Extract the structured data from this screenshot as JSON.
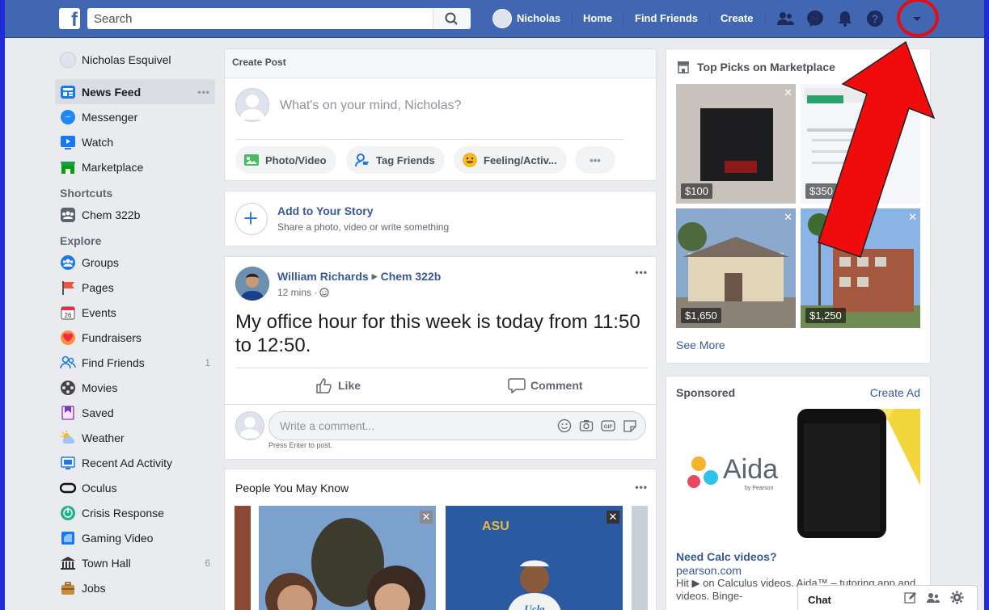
{
  "topbar": {
    "search_placeholder": "Search",
    "user": "Nicholas",
    "home": "Home",
    "find_friends": "Find Friends",
    "create": "Create"
  },
  "sidebar": {
    "profile": "Nicholas Esquivel",
    "main": [
      {
        "label": "News Feed",
        "icon": "news-feed-icon"
      },
      {
        "label": "Messenger",
        "icon": "messenger-icon"
      },
      {
        "label": "Watch",
        "icon": "watch-icon"
      },
      {
        "label": "Marketplace",
        "icon": "marketplace-icon"
      }
    ],
    "shortcuts_title": "Shortcuts",
    "shortcuts": [
      {
        "label": "Chem 322b",
        "icon": "group-icon"
      }
    ],
    "explore_title": "Explore",
    "explore": [
      {
        "label": "Groups",
        "icon": "groups-icon",
        "count": ""
      },
      {
        "label": "Pages",
        "icon": "pages-flag-icon",
        "count": ""
      },
      {
        "label": "Events",
        "icon": "calendar-icon",
        "count": ""
      },
      {
        "label": "Fundraisers",
        "icon": "fundraisers-icon",
        "count": ""
      },
      {
        "label": "Find Friends",
        "icon": "find-friends-icon",
        "count": "1"
      },
      {
        "label": "Movies",
        "icon": "film-reel-icon",
        "count": ""
      },
      {
        "label": "Saved",
        "icon": "bookmark-icon",
        "count": ""
      },
      {
        "label": "Weather",
        "icon": "weather-icon",
        "count": ""
      },
      {
        "label": "Recent Ad Activity",
        "icon": "ad-activity-icon",
        "count": ""
      },
      {
        "label": "Oculus",
        "icon": "oculus-icon",
        "count": ""
      },
      {
        "label": "Crisis Response",
        "icon": "crisis-icon",
        "count": ""
      },
      {
        "label": "Gaming Video",
        "icon": "gaming-icon",
        "count": ""
      },
      {
        "label": "Town Hall",
        "icon": "town-hall-icon",
        "count": "6"
      },
      {
        "label": "Jobs",
        "icon": "briefcase-icon",
        "count": ""
      }
    ]
  },
  "create_post": {
    "title": "Create Post",
    "placeholder": "What's on your mind, Nicholas?",
    "photo_video": "Photo/Video",
    "tag_friends": "Tag Friends",
    "feeling": "Feeling/Activ...",
    "more": "•••"
  },
  "story": {
    "title": "Add to Your Story",
    "subtitle": "Share a photo, video or write something"
  },
  "post": {
    "author": "William Richards",
    "group": "Chem 322b",
    "time": "12 mins ·",
    "text": "My office hour for this week is today from 11:50 to 12:50.",
    "like": "Like",
    "comment": "Comment",
    "comment_placeholder": "Write a comment...",
    "hint": "Press Enter to post."
  },
  "pymk": {
    "title": "People You May Know"
  },
  "marketplace": {
    "title": "Top Picks on Marketplace",
    "prices": [
      "$100",
      "$350",
      "$1,650",
      "$1,250"
    ],
    "see_more": "See More"
  },
  "sponsored": {
    "title": "Sponsored",
    "create_ad": "Create Ad",
    "brand": "Aida",
    "brand_sub": "by Pearson",
    "headline": "Need Calc videos?",
    "domain": "pearson.com",
    "body": "Hit ▶ on Calculus videos. Aida™ – tutoring app and videos. Binge-"
  },
  "chat": {
    "label": "Chat"
  },
  "colors": {
    "brand": "#4267b2",
    "background": "#e9ebee",
    "annotation": "#e30d16"
  }
}
